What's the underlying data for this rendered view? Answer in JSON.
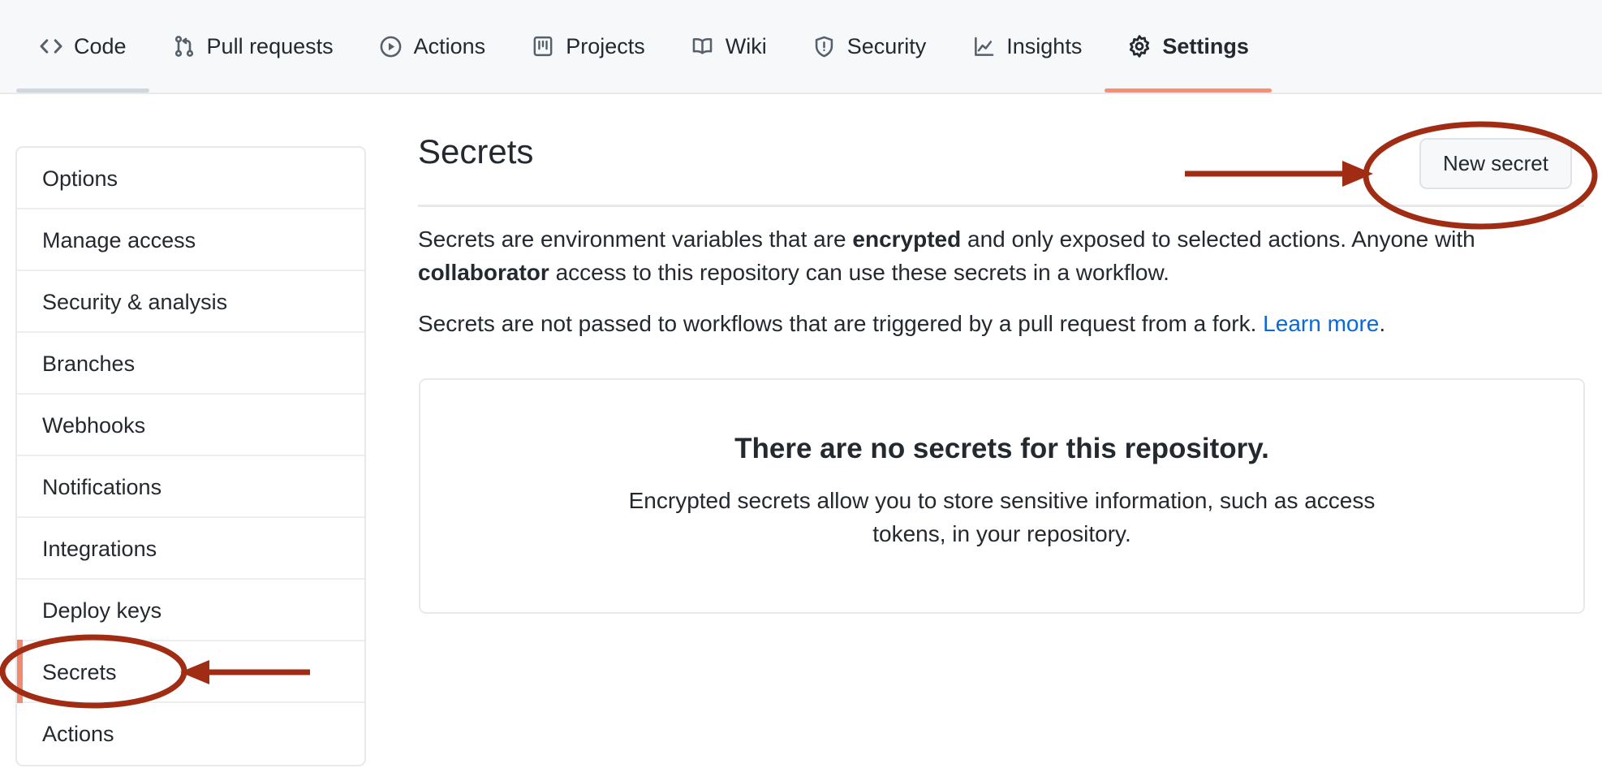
{
  "repo_nav": {
    "tabs": [
      {
        "label": "Code",
        "icon": "code-icon",
        "state": "hover"
      },
      {
        "label": "Pull requests",
        "icon": "git-pull-request-icon",
        "state": "default"
      },
      {
        "label": "Actions",
        "icon": "play-circle-icon",
        "state": "default"
      },
      {
        "label": "Projects",
        "icon": "project-board-icon",
        "state": "default"
      },
      {
        "label": "Wiki",
        "icon": "book-icon",
        "state": "default"
      },
      {
        "label": "Security",
        "icon": "shield-alert-icon",
        "state": "default"
      },
      {
        "label": "Insights",
        "icon": "graph-line-icon",
        "state": "default"
      },
      {
        "label": "Settings",
        "icon": "gear-icon",
        "state": "selected"
      }
    ],
    "selected_tab": "Settings",
    "selected_underline_color": "#fd8c73",
    "hover_underline_color": "#d0d7de",
    "background_color": "#f6f8fa"
  },
  "sidebar": {
    "items": [
      {
        "label": "Options",
        "selected": false
      },
      {
        "label": "Manage access",
        "selected": false
      },
      {
        "label": "Security & analysis",
        "selected": false
      },
      {
        "label": "Branches",
        "selected": false
      },
      {
        "label": "Webhooks",
        "selected": false
      },
      {
        "label": "Notifications",
        "selected": false
      },
      {
        "label": "Integrations",
        "selected": false
      },
      {
        "label": "Deploy keys",
        "selected": false
      },
      {
        "label": "Secrets",
        "selected": true
      },
      {
        "label": "Actions",
        "selected": false
      }
    ],
    "selected_item": "Secrets",
    "selected_marker_color": "#f08a70"
  },
  "main": {
    "title": "Secrets",
    "new_secret_label": "New secret",
    "paragraph_one": {
      "part_1": "Secrets are environment variables that are ",
      "bold_1": "encrypted",
      "part_2": " and only exposed to selected actions. Anyone with ",
      "bold_2": "collaborator",
      "part_3": " access to this repository can use these secrets in a workflow."
    },
    "paragraph_two": {
      "part_1": "Secrets are not passed to workflows that are triggered by a pull request from a fork. ",
      "link_text": "Learn more",
      "part_2": "."
    },
    "link_color": "#0969da",
    "empty_state": {
      "title": "There are no secrets for this repository.",
      "description": "Encrypted secrets allow you to store sensitive information, such as access tokens, in your repository."
    }
  },
  "annotations": {
    "color": "#a02c13",
    "items": [
      {
        "shape": "ellipse",
        "target": "new-secret-button"
      },
      {
        "shape": "arrow",
        "target": "new-secret-button",
        "direction": "right"
      },
      {
        "shape": "ellipse",
        "target": "sidebar-item-secrets"
      },
      {
        "shape": "arrow",
        "target": "sidebar-item-secrets",
        "direction": "left"
      }
    ]
  }
}
